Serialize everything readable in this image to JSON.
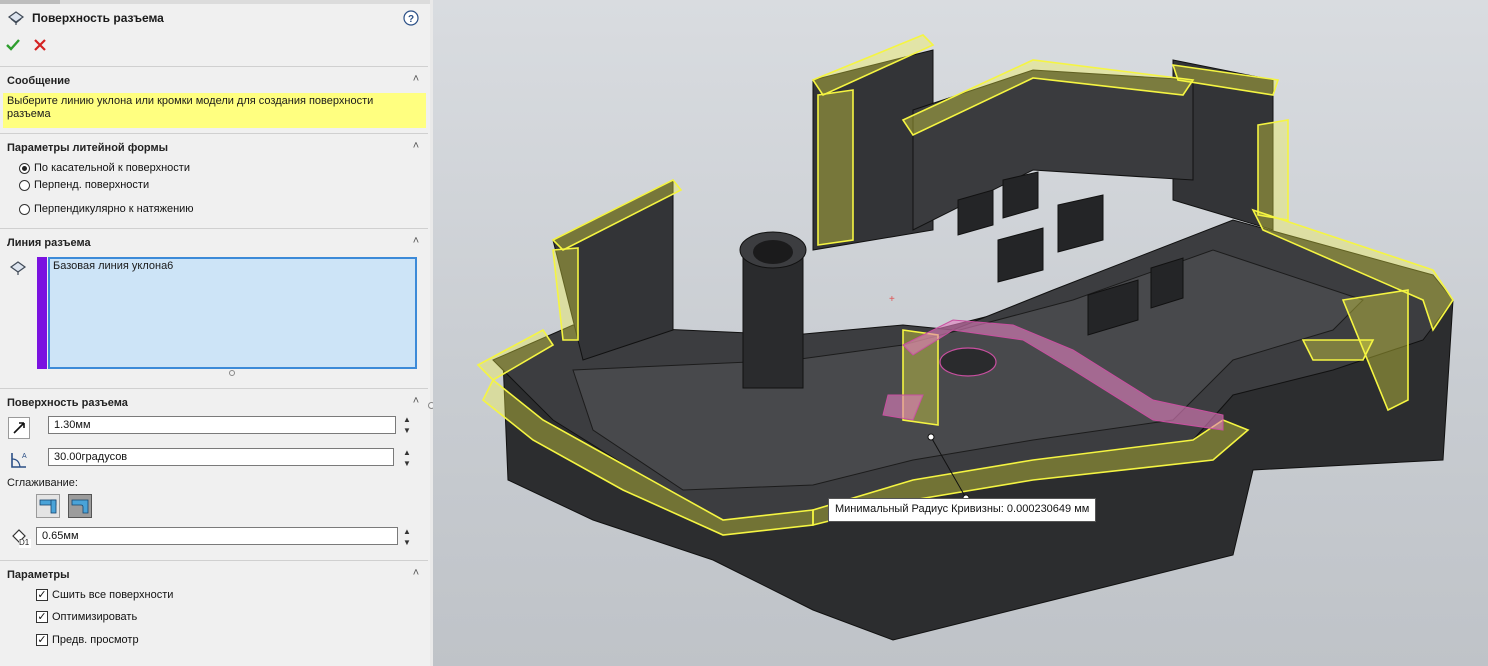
{
  "header": {
    "title": "Поверхность разъема",
    "icon": "parting-surface-icon",
    "help_icon": "help-icon",
    "ok_icon": "checkmark-icon",
    "cancel_icon": "close-icon"
  },
  "message": {
    "heading": "Сообщение",
    "text": "Выберите линию уклона или кромки модели для создания поверхности разъема"
  },
  "mold_params": {
    "heading": "Параметры литейной формы",
    "options": [
      {
        "label": "По касательной к поверхности",
        "selected": true
      },
      {
        "label": "Перпенд. поверхности",
        "selected": false
      },
      {
        "label": "Перпендикулярно к натяжению",
        "selected": false
      }
    ]
  },
  "parting_line": {
    "heading": "Линия разъема",
    "selection": "Базовая линия уклона6",
    "color": "#7a12e0"
  },
  "parting_surface": {
    "heading": "Поверхность разъема",
    "distance": "1.30мм",
    "angle": "30.00градусов",
    "smoothing_label": "Сглаживание:",
    "smoothing_value": "0.65мм",
    "d1_label": "D1"
  },
  "options": {
    "heading": "Параметры",
    "items": [
      {
        "label": "Сшить все поверхности",
        "checked": true
      },
      {
        "label": "Оптимизировать",
        "checked": true
      },
      {
        "label": "Предв. просмотр",
        "checked": true
      }
    ]
  },
  "viewport": {
    "tooltip": "Минимальный Радиус Кривизны: 0.000230649 мм",
    "highlight_color": "#f5f542",
    "curvature_color": "#e37fc0"
  },
  "colors": {
    "message_bg": "#ffff80",
    "listbox_bg": "#cde4f7",
    "listbox_border": "#3c8ad8",
    "ok_green": "#2e9e2e",
    "cancel_red": "#d42222"
  }
}
